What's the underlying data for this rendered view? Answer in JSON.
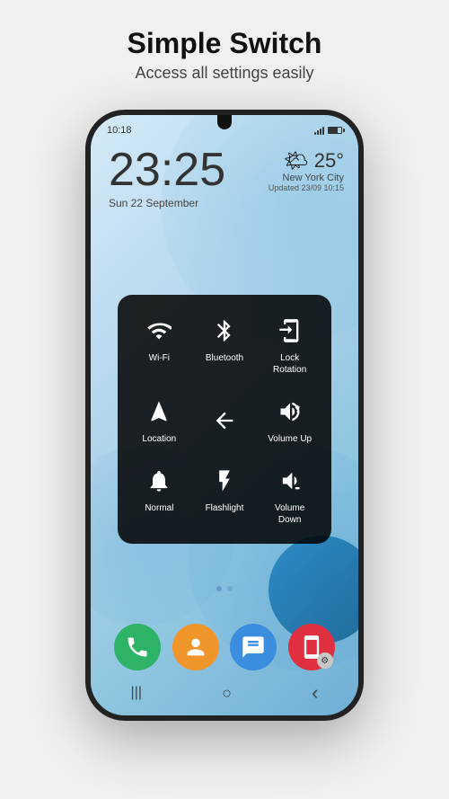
{
  "header": {
    "title": "Simple Switch",
    "subtitle": "Access all settings easily"
  },
  "phone": {
    "status_time": "10:18",
    "clock_time": "23:25",
    "clock_date": "Sun 22 September",
    "weather": {
      "temp": "25°",
      "city": "New York City",
      "updated": "Updated 23/09 10:15",
      "emoji": "🌤"
    },
    "quick_settings": {
      "items": [
        {
          "id": "wifi",
          "label": "Wi-Fi",
          "icon": "wifi"
        },
        {
          "id": "bluetooth",
          "label": "Bluetooth",
          "icon": "bluetooth"
        },
        {
          "id": "lock-rotation",
          "label": "Lock Rotation",
          "icon": "lock-rotation"
        },
        {
          "id": "location",
          "label": "Location",
          "icon": "location"
        },
        {
          "id": "back",
          "label": "",
          "icon": "back"
        },
        {
          "id": "volume-up",
          "label": "Volume Up",
          "icon": "volume-up"
        },
        {
          "id": "normal",
          "label": "Normal",
          "icon": "bell"
        },
        {
          "id": "flashlight",
          "label": "Flashlight",
          "icon": "flashlight"
        },
        {
          "id": "volume-down",
          "label": "Volume Down",
          "icon": "volume-down"
        }
      ]
    },
    "apps": [
      {
        "id": "phone",
        "label": "Phone",
        "emoji": "📞",
        "color": "#2db366"
      },
      {
        "id": "contacts",
        "label": "Contacts",
        "emoji": "👤",
        "color": "#f0952a"
      },
      {
        "id": "messages",
        "label": "Messages",
        "emoji": "💬",
        "color": "#3b8de0"
      },
      {
        "id": "screen",
        "label": "Screen",
        "emoji": "📱",
        "color": "#e03040",
        "has_gear": true
      }
    ],
    "nav": {
      "menu": "|||",
      "home": "○",
      "back": "‹"
    }
  }
}
